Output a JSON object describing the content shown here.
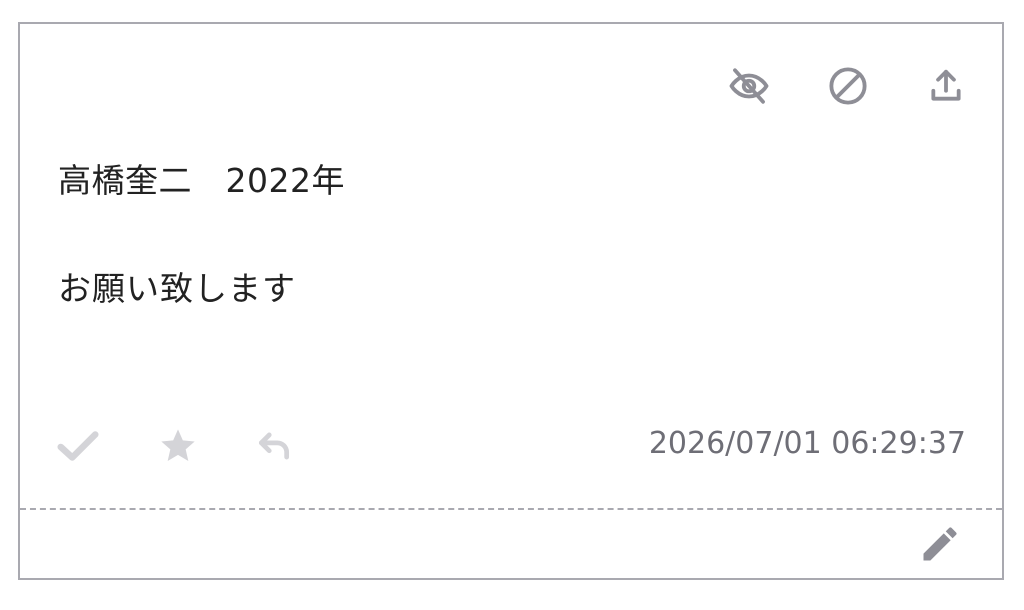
{
  "post": {
    "title": "高橋奎二　2022年",
    "body": "お願い致します",
    "timestamp": "2026/07/01 06:29:37"
  },
  "icons": {
    "hide": "eye-off-icon",
    "block": "block-icon",
    "share": "upload-icon",
    "check": "check-icon",
    "star": "star-icon",
    "reply": "reply-icon",
    "edit": "pencil-icon"
  },
  "colors": {
    "border": "#a9a9b0",
    "icon_dark": "#8e8e96",
    "icon_light": "#d4d4d8",
    "text": "#222222",
    "muted_text": "#6e6e76"
  }
}
